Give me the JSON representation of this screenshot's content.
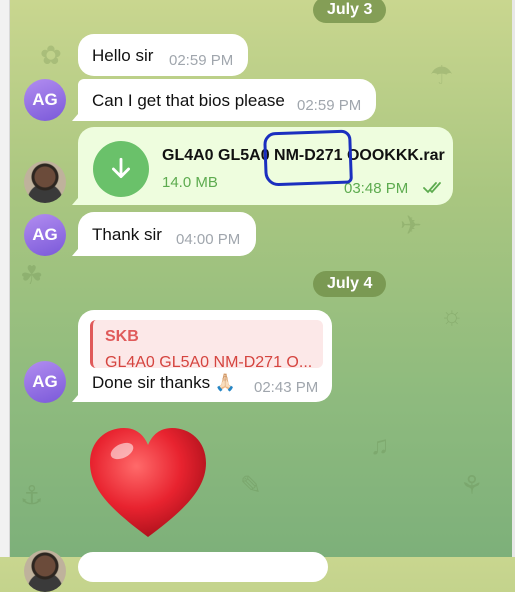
{
  "dates": {
    "first": "July 3",
    "second": "July 4"
  },
  "avatars": {
    "ag_initials": "AG"
  },
  "messages": {
    "m1": {
      "text": "Hello sir",
      "time": "02:59 PM"
    },
    "m2": {
      "text": "Can I get that bios please",
      "time": "02:59 PM"
    },
    "m3": {
      "file_name": "GL4A0 GL5A0 NM-D271 OOOKKK.rar",
      "size": "14.0 MB",
      "time": "03:48 PM",
      "status": "read"
    },
    "m4": {
      "text": "Thank sir",
      "time": "04:00 PM"
    },
    "m5": {
      "reply_author": "SKB",
      "reply_snippet": "GL4A0 GL5A0 NM-D271 O...",
      "text": "Done sir thanks 🙏🏻",
      "time": "02:43 PM"
    }
  },
  "colors": {
    "incoming_bubble": "#ffffff",
    "outgoing_bubble": "#eefdde",
    "avatar_gradient": "#8f6de6",
    "date_pill": "#718e46",
    "heart": "#e8232f",
    "annotation": "#1a2fbf"
  },
  "icons": [
    "download-icon",
    "double-check-icon",
    "heart-sticker"
  ]
}
